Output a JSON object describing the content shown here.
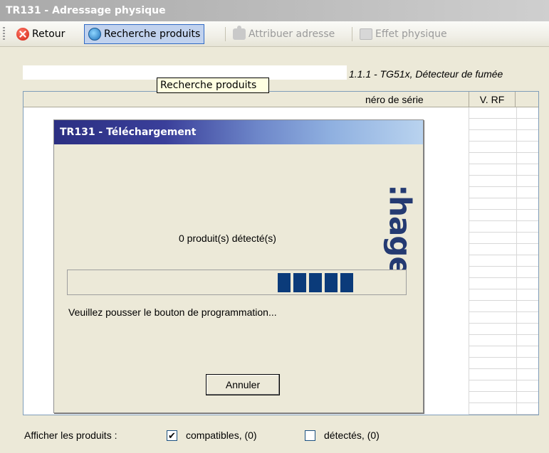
{
  "window": {
    "title": "TR131 - Adressage physique"
  },
  "toolbar": {
    "back_label": "Retour",
    "search_label": "Recherche produits",
    "assign_label": "Attribuer adresse",
    "effect_label": "Effet physique"
  },
  "main": {
    "device_info": "1.1.1 - TG51x, Détecteur de fumée",
    "columns": {
      "serial": "néro de série",
      "rf": "V. RF"
    }
  },
  "tooltip": {
    "text": "Recherche produits"
  },
  "dialog": {
    "title": "TR131 - Téléchargement",
    "logo": ":hager",
    "detected_text": "0 produit(s) détecté(s)",
    "instructions": "Veuillez pousser le bouton de programmation...",
    "cancel_label": "Annuler"
  },
  "footer": {
    "label": "Afficher les produits :",
    "compatible": {
      "label": "compatibles, (0)",
      "checked": true
    },
    "detected": {
      "label": "détectés, (0)",
      "checked": false
    }
  },
  "colors": {
    "dialog_title_start": "#2b2f82",
    "progress_block": "#0b3b7a",
    "logo": "#243a72"
  },
  "icons": [
    "close-icon",
    "globe-search-icon",
    "puzzle-icon",
    "effect-icon"
  ]
}
